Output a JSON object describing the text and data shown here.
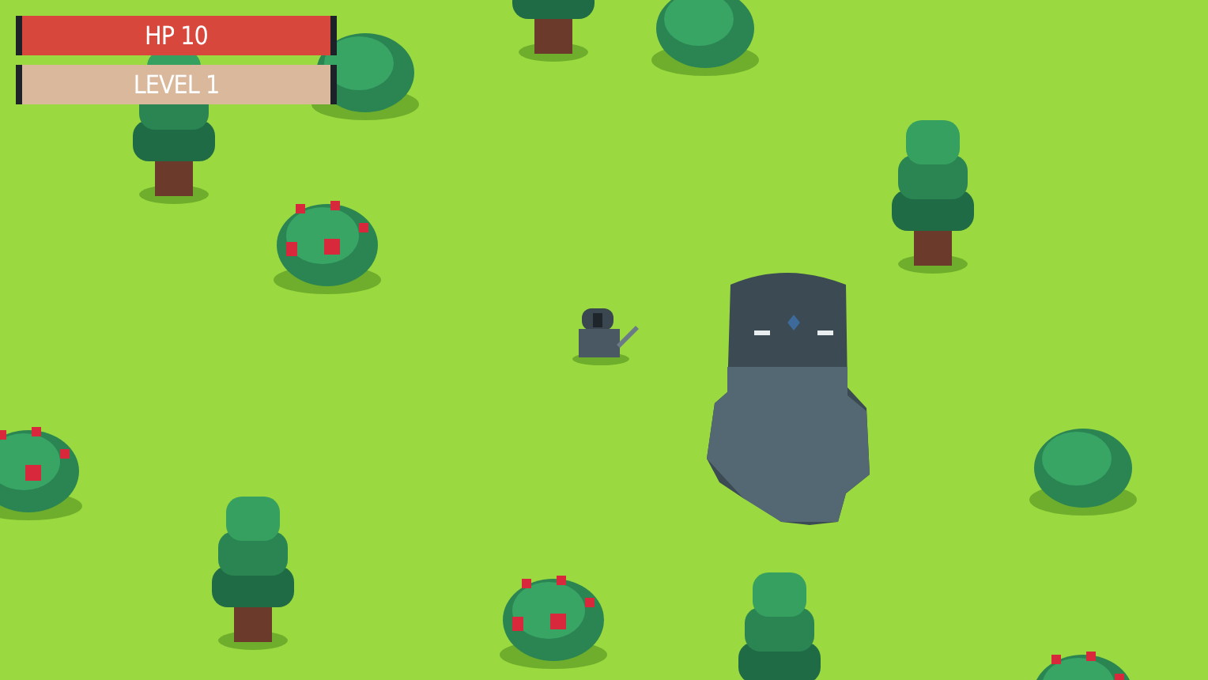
{
  "hud": {
    "bars": [
      {
        "kind": "health",
        "label": "HP 10"
      },
      {
        "kind": "level",
        "label": "LEVEL 1"
      }
    ]
  }
}
